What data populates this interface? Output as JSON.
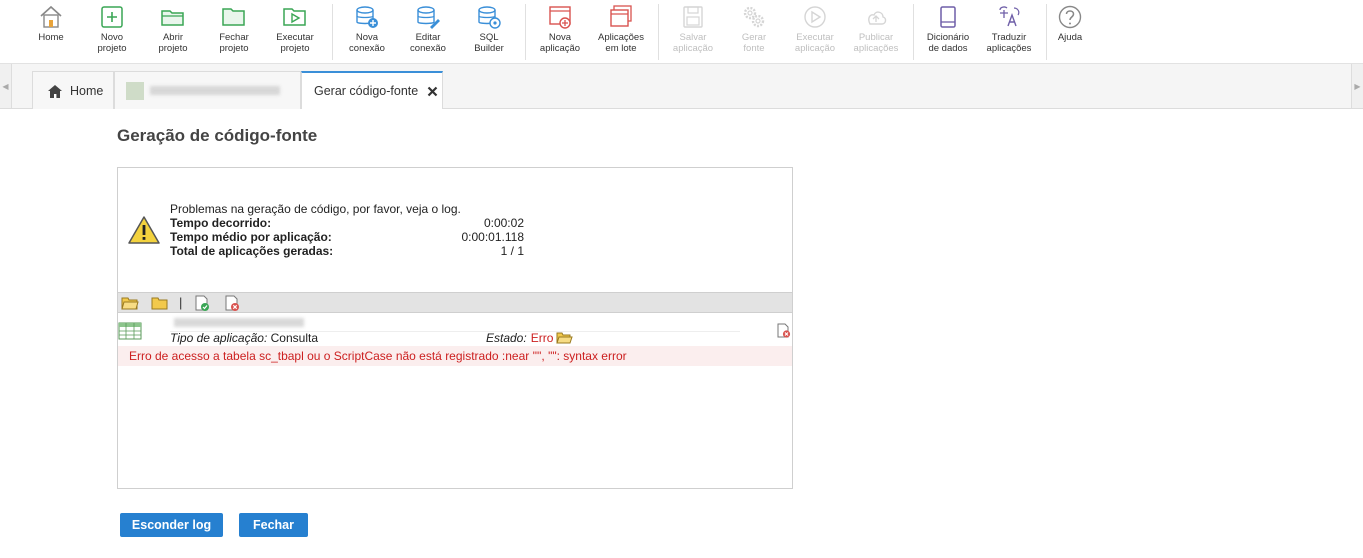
{
  "toolbar": {
    "items": [
      {
        "label1": "Home",
        "label2": "",
        "icon": "home-icon"
      },
      {
        "label1": "Novo",
        "label2": "projeto",
        "icon": "new-project-icon"
      },
      {
        "label1": "Abrir",
        "label2": "projeto",
        "icon": "open-folder-icon"
      },
      {
        "label1": "Fechar",
        "label2": "projeto",
        "icon": "close-folder-icon"
      },
      {
        "label1": "Executar",
        "label2": "projeto",
        "icon": "run-project-icon"
      },
      {
        "label1": "Nova",
        "label2": "conexão",
        "icon": "new-connection-icon"
      },
      {
        "label1": "Editar",
        "label2": "conexão",
        "icon": "edit-connection-icon"
      },
      {
        "label1": "SQL",
        "label2": "Builder",
        "icon": "sql-builder-icon"
      },
      {
        "label1": "Nova",
        "label2": "aplicação",
        "icon": "new-application-icon"
      },
      {
        "label1": "Aplicações",
        "label2": "em lote",
        "icon": "batch-applications-icon"
      },
      {
        "label1": "Salvar",
        "label2": "aplicação",
        "icon": "save-icon"
      },
      {
        "label1": "Gerar",
        "label2": "fonte",
        "icon": "gears-icon"
      },
      {
        "label1": "Executar",
        "label2": "aplicação",
        "icon": "play-icon"
      },
      {
        "label1": "Publicar",
        "label2": "aplicações",
        "icon": "cloud-upload-icon"
      },
      {
        "label1": "Dicionário",
        "label2": "de dados",
        "icon": "dictionary-icon"
      },
      {
        "label1": "Traduzir",
        "label2": "aplicações",
        "icon": "translate-icon"
      },
      {
        "label1": "Ajuda",
        "label2": "",
        "icon": "help-icon"
      }
    ]
  },
  "tabs": {
    "home": "Home",
    "active": "Gerar código-fonte"
  },
  "page": {
    "title": "Geração de código-fonte"
  },
  "result": {
    "message": "Problemas na geração de código, por favor, veja o log.",
    "elapsed_label": "Tempo decorrido:",
    "elapsed_value": "0:00:02",
    "avg_label": "Tempo médio por aplicação:",
    "avg_value": "0:00:01.118",
    "total_label": "Total de aplicações geradas:",
    "total_value": "1 / 1"
  },
  "log": {
    "separator": "|",
    "app_type_label": "Tipo de aplicação:",
    "app_type_value": "Consulta",
    "status_label": "Estado:",
    "status_value": "Erro",
    "error_message": "Erro de acesso a tabela sc_tbapl ou o ScriptCase não está registrado :near '\"', \"\": syntax error"
  },
  "buttons": {
    "hide_log": "Esconder log",
    "close": "Fechar"
  },
  "colors": {
    "accent": "#2680d0",
    "error": "#cc1f1f",
    "icon_green": "#3aa655",
    "icon_blue": "#3a8fd8",
    "icon_red": "#d9534f",
    "icon_purple": "#6f5fa8"
  }
}
